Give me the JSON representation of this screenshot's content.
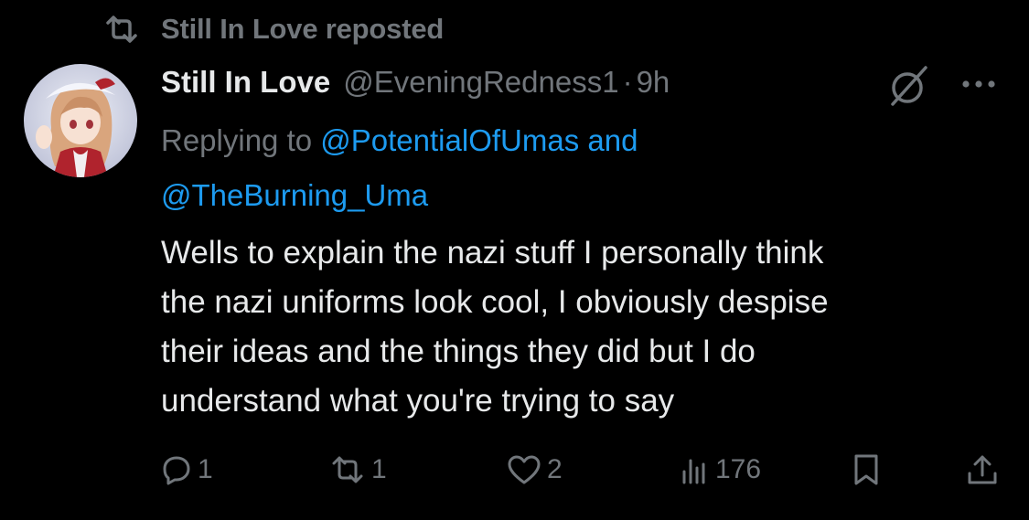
{
  "repost_banner": {
    "icon": "repost-icon",
    "text": "Still In Love reposted"
  },
  "tweet": {
    "avatar": "avatar-image",
    "display_name": "Still In Love",
    "handle": "@EveningRedness1",
    "separator": "·",
    "time": "9h",
    "replying_prefix": "Replying to ",
    "replying_mention_1": "@PotentialOfUmas",
    "replying_and": " and",
    "replying_mention_2": "@TheBurning_Uma",
    "body_lines": [
      "Wells to explain the nazi stuff I personally think",
      "the nazi uniforms look cool, I obviously despise",
      "their ideas and the things they did but I do",
      "understand what you're trying to say"
    ]
  },
  "actions": {
    "reply_count": "1",
    "repost_count": "1",
    "like_count": "2",
    "views_count": "176"
  },
  "colors": {
    "background": "#000000",
    "text": "#e7e9ea",
    "muted": "#71767b",
    "link": "#1d9bf0"
  }
}
